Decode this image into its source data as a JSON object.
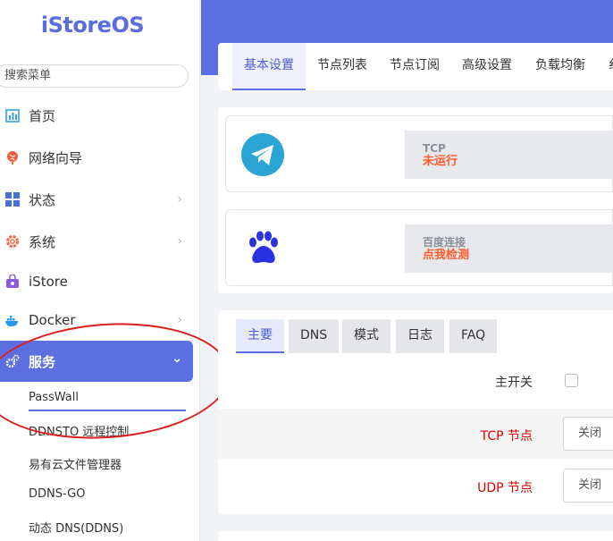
{
  "brand": "iStoreOS",
  "search": {
    "placeholder": "搜索菜单"
  },
  "sidebar": {
    "items": [
      {
        "label": "首页",
        "icon": "dashboard-icon",
        "chevron": false
      },
      {
        "label": "网络向导",
        "icon": "globe-wizard-icon",
        "chevron": false
      },
      {
        "label": "状态",
        "icon": "grid-icon",
        "chevron": true
      },
      {
        "label": "系统",
        "icon": "gear-icon",
        "chevron": true
      },
      {
        "label": "iStore",
        "icon": "store-icon",
        "chevron": false
      },
      {
        "label": "Docker",
        "icon": "docker-icon",
        "chevron": true
      },
      {
        "label": "服务",
        "icon": "services-gear-icon",
        "chevron": true,
        "active": true
      }
    ],
    "subitems": [
      {
        "label": "PassWall",
        "active": true
      },
      {
        "label": "DDNSTO 远程控制"
      },
      {
        "label": "易有云文件管理器"
      },
      {
        "label": "DDNS-GO"
      },
      {
        "label": "动态 DNS(DDNS)"
      }
    ]
  },
  "tabs": [
    "基本设置",
    "节点列表",
    "节点订阅",
    "高级设置",
    "负载均衡",
    "纟"
  ],
  "status": {
    "tcp": {
      "label": "TCP",
      "value": "未运行"
    },
    "baidu": {
      "label": "百度连接",
      "value": "点我检测"
    }
  },
  "settings": {
    "tabs": [
      "主要",
      "DNS",
      "模式",
      "日志",
      "FAQ"
    ],
    "main_switch_label": "主开关",
    "tcp_node_label": "TCP 节点",
    "tcp_node_value": "关闭",
    "udp_node_label": "UDP 节点",
    "udp_node_value": "关闭"
  },
  "colors": {
    "accent": "#5c6fe0",
    "status_value": "#ff5a2b",
    "required_label": "#e00000",
    "annotation": "#d9201f"
  }
}
